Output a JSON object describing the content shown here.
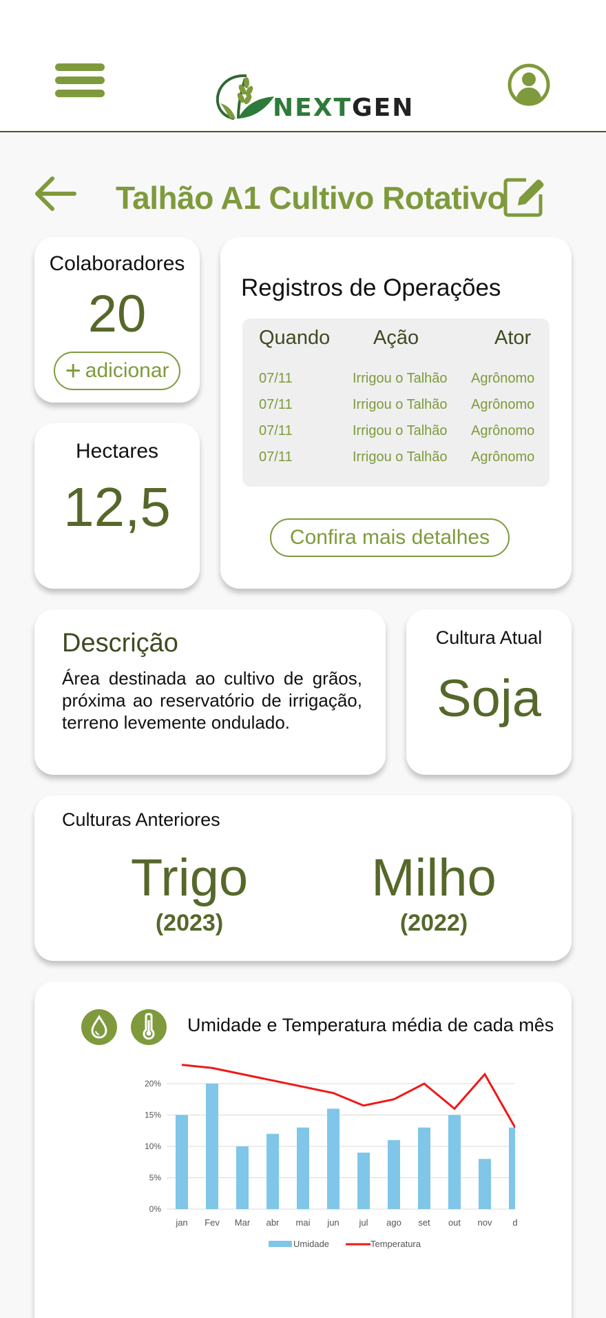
{
  "app": {
    "logo_part1": "NEXT",
    "logo_part2": "GEN"
  },
  "colors": {
    "accent": "#7e9a3c",
    "dark_green": "#55682a",
    "humidity_bar": "#7fc6e9",
    "temperature_line": "#f01818"
  },
  "page": {
    "title": "Talhão A1 Cultivo Rotativo"
  },
  "collaborators": {
    "label": "Colaboradores",
    "count": "20",
    "add_label": "adicionar"
  },
  "hectares": {
    "label": "Hectares",
    "value": "12,5"
  },
  "operations": {
    "title": "Registros de Operações",
    "columns": [
      "Quando",
      "Ação",
      "Ator"
    ],
    "rows": [
      [
        "07/11",
        "Irrigou o Talhão",
        "Agrônomo"
      ],
      [
        "07/11",
        "Irrigou o Talhão",
        "Agrônomo"
      ],
      [
        "07/11",
        "Irrigou o Talhão",
        "Agrônomo"
      ],
      [
        "07/11",
        "Irrigou o Talhão",
        "Agrônomo"
      ]
    ],
    "details_label": "Confira mais detalhes"
  },
  "description": {
    "title": "Descrição",
    "text": "Área destinada ao cultivo de grãos, próxima ao reservatório de irrigação, terreno levemente ondulado."
  },
  "current_crop": {
    "label": "Cultura Atual",
    "value": "Soja"
  },
  "previous_crops": {
    "label": "Culturas Anteriores",
    "items": [
      {
        "name": "Trigo",
        "year": "(2023)"
      },
      {
        "name": "Milho",
        "year": "(2022)"
      }
    ]
  },
  "chart_section": {
    "title": "Umidade e Temperatura média de cada mês"
  },
  "chart_data": {
    "type": "bar",
    "categories": [
      "jan",
      "Fev",
      "Mar",
      "abr",
      "mai",
      "jun",
      "jul",
      "ago",
      "set",
      "out",
      "nov",
      "d"
    ],
    "series": [
      {
        "name": "Umidade",
        "type": "bar",
        "values": [
          15,
          20,
          10,
          12,
          13,
          16,
          9,
          11,
          13,
          15,
          8,
          13
        ]
      },
      {
        "name": "Temperatura",
        "type": "line",
        "values": [
          23,
          22.5,
          21.5,
          20.5,
          19.5,
          18.5,
          16.5,
          17.5,
          20,
          16,
          21.5,
          13
        ]
      }
    ],
    "yticks": [
      "0%",
      "5%",
      "10%",
      "15%",
      "20%"
    ],
    "ylim": [
      0,
      20
    ],
    "grid": true,
    "legend": "bottom"
  }
}
